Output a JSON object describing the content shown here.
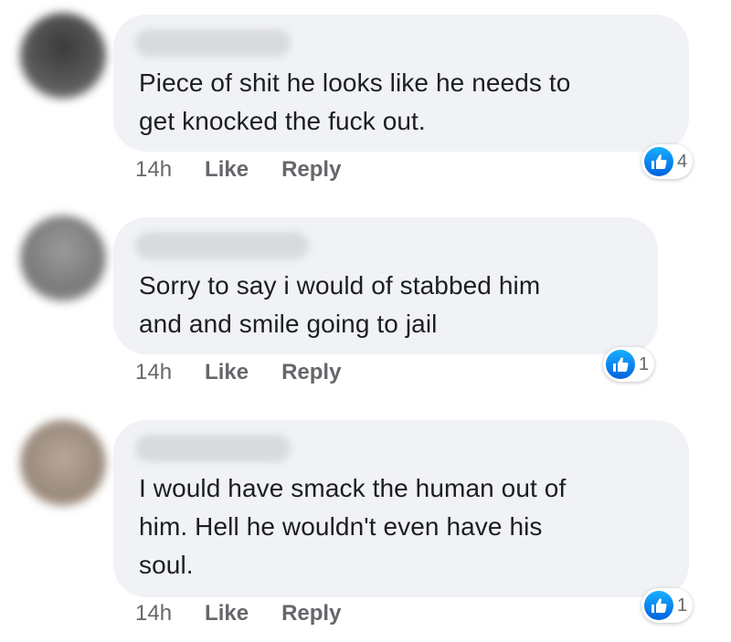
{
  "colors": {
    "bubble_bg": "#f0f2f5",
    "text": "#1c1e21",
    "meta": "#65676b",
    "like_blue": "#1877f2"
  },
  "comments": [
    {
      "text": "Piece of shit he looks like he needs to\nget knocked the fuck out.",
      "time": "14h",
      "like_label": "Like",
      "reply_label": "Reply",
      "reaction_icon": "thumbs-up-icon",
      "reaction_count": "4"
    },
    {
      "text": "Sorry to say i would of stabbed him\nand and smile going to jail",
      "time": "14h",
      "like_label": "Like",
      "reply_label": "Reply",
      "reaction_icon": "thumbs-up-icon",
      "reaction_count": "1"
    },
    {
      "text": "I would have smack the human out of\nhim. Hell he wouldn't even have his\nsoul.",
      "time": "14h",
      "like_label": "Like",
      "reply_label": "Reply",
      "reaction_icon": "thumbs-up-icon",
      "reaction_count": "1"
    }
  ]
}
